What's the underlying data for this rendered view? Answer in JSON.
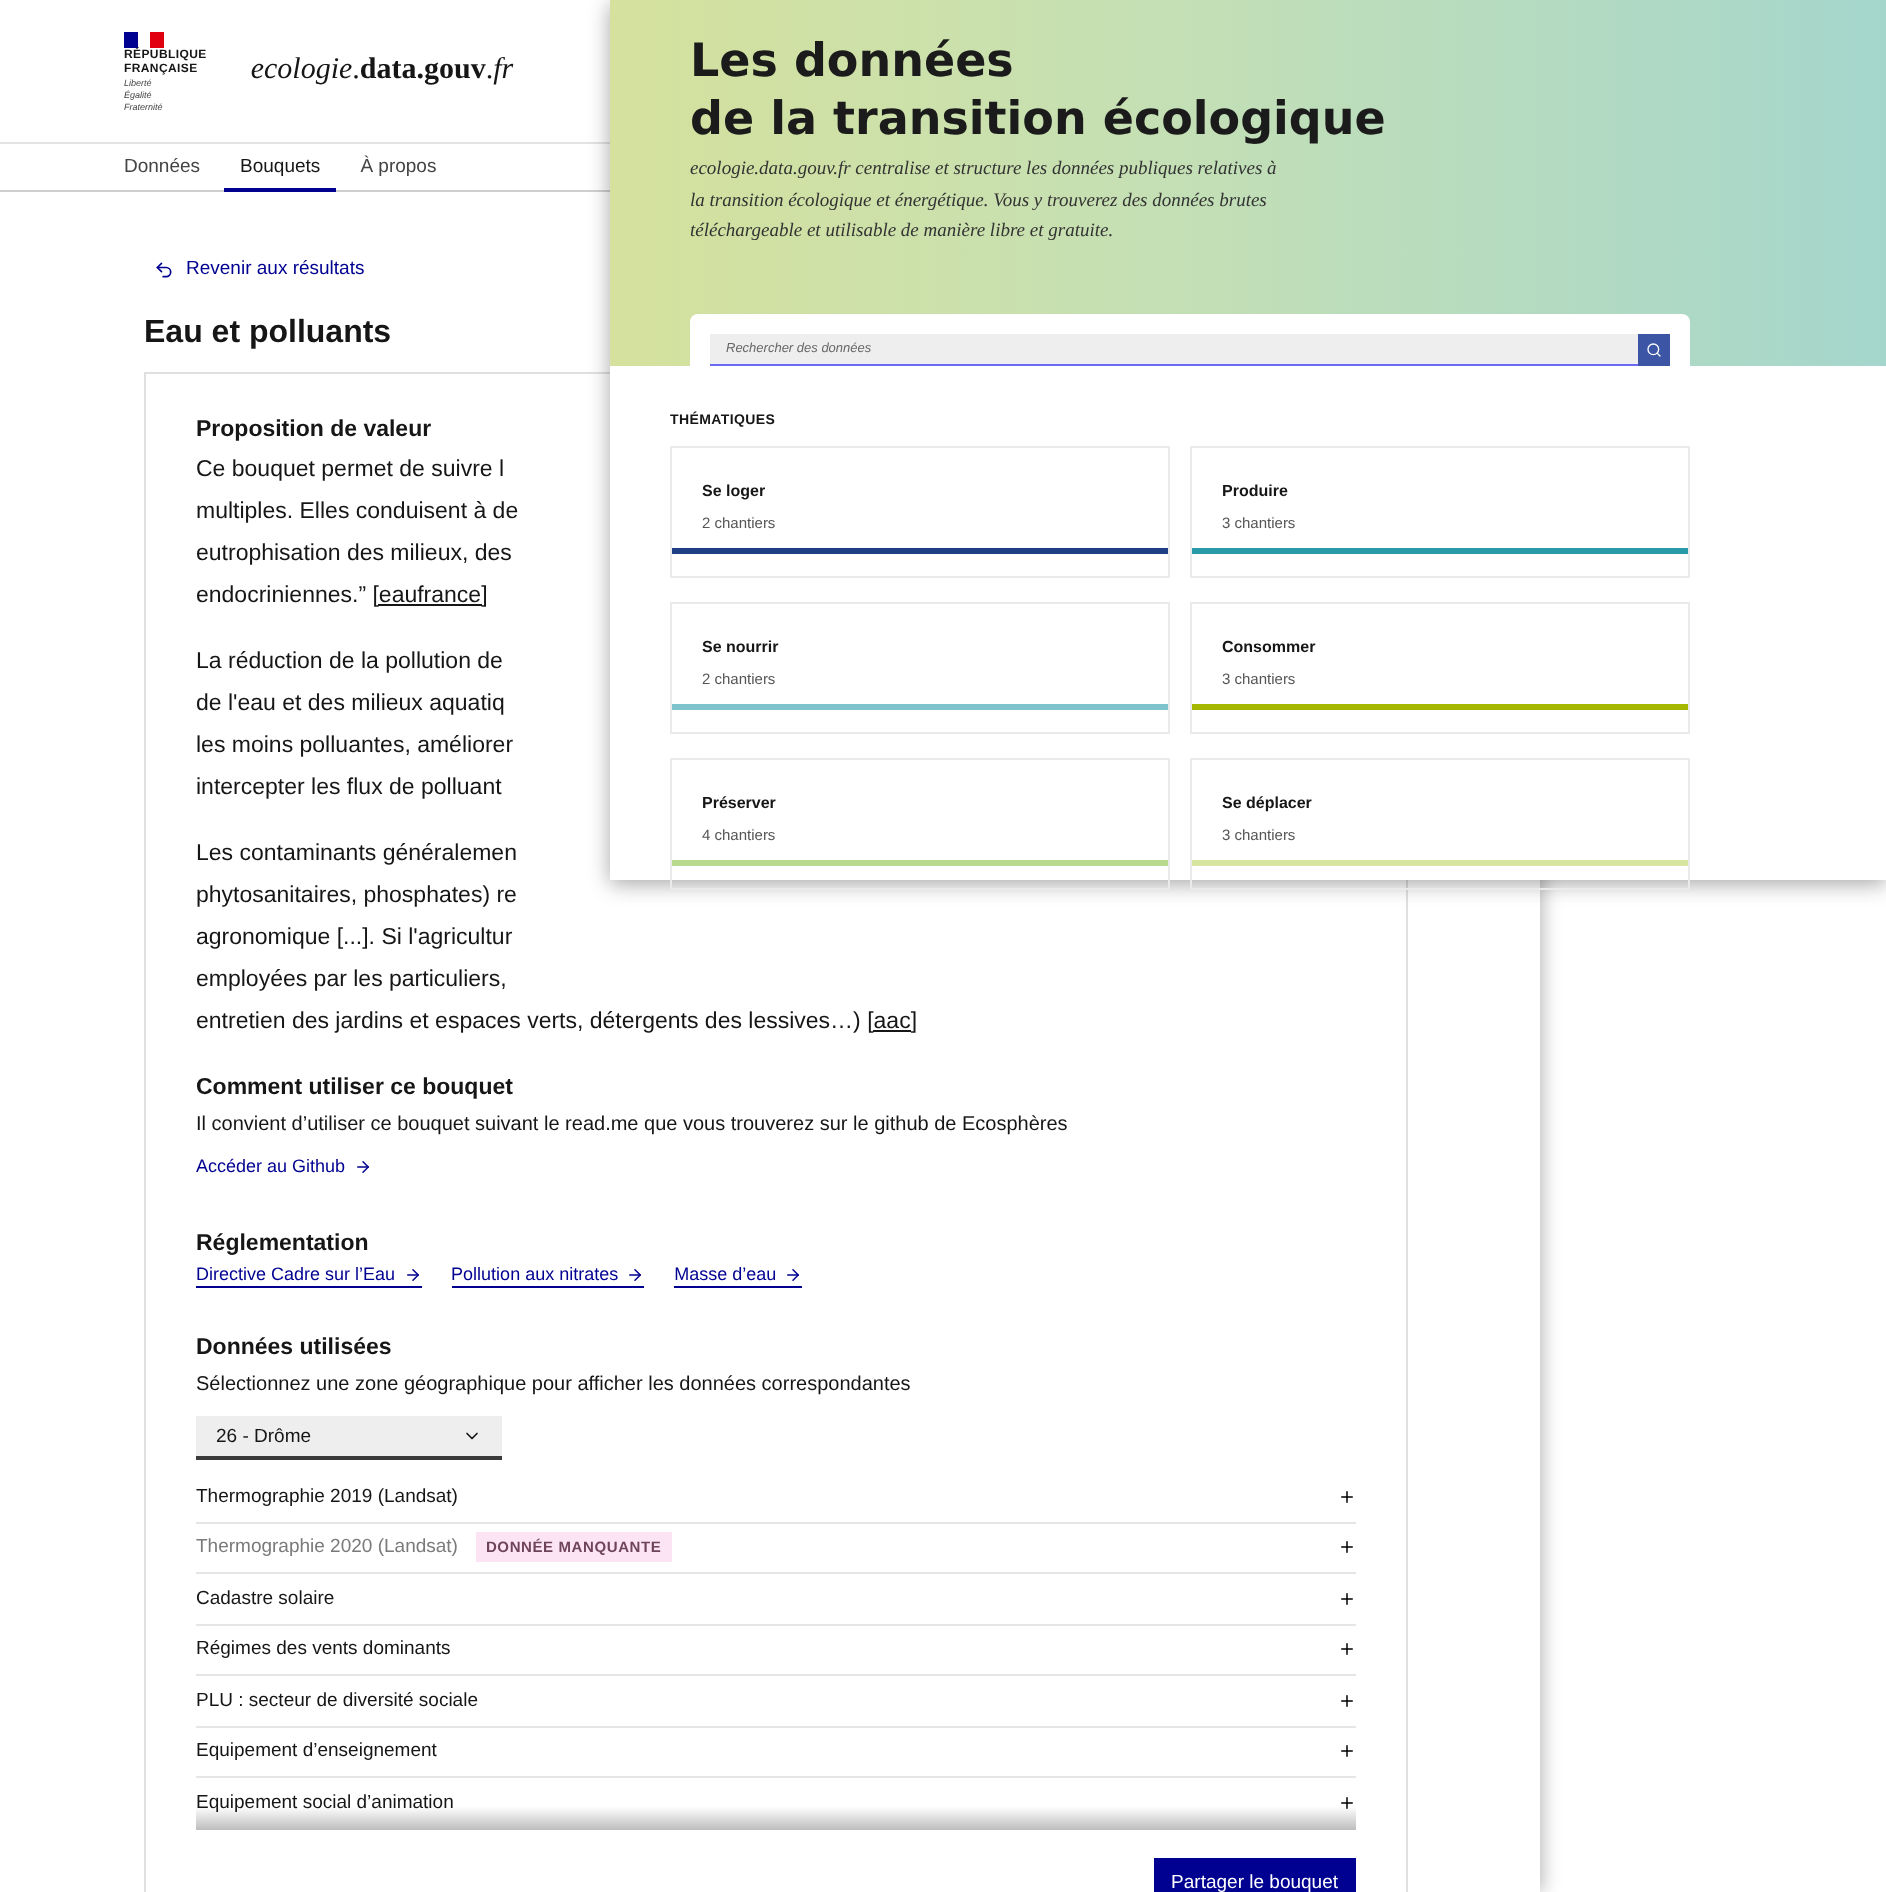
{
  "back_window": {
    "header": {
      "logo_lines": [
        "RÉPUBLIQUE",
        "FRANÇAISE"
      ],
      "motto_lines": [
        "Liberté",
        "Égalité",
        "Fraternité"
      ],
      "site_name": "*ecologie*.**data.gouv**.*fr*"
    },
    "nav": [
      {
        "label": "Données",
        "selected": false
      },
      {
        "label": "Bouquets",
        "selected": true
      },
      {
        "label": "À propos",
        "selected": false
      }
    ],
    "back_link": "Revenir aux résultats",
    "title": "Eau et polluants",
    "value_proposition": {
      "heading": "Proposition de valeur",
      "paragraphs": [
        {
          "lines": [
            {
              "text": "Ce bouquet permet de suivre l"
            },
            {
              "text": "multiples. Elles conduisent à de"
            },
            {
              "text": "eutrophisation des milieux, des"
            },
            {
              "text": "endocriniennes.”",
              "link": "[eaufrance]"
            }
          ]
        },
        {
          "lines": [
            {
              "text": "La réduction de la pollution de"
            },
            {
              "text": "de l'eau et des milieux aquatiq"
            },
            {
              "text": "les moins polluantes, améliorer"
            },
            {
              "text": "intercepter les flux de polluant"
            }
          ]
        },
        {
          "lines": [
            {
              "text": "Les contaminants généralemen"
            },
            {
              "text": "phytosanitaires, phosphates) re"
            },
            {
              "text": "agronomique [...]. Si l'agricultur"
            },
            {
              "text": "employées par les particuliers,"
            },
            {
              "text": "entretien des jardins et espaces verts, détergents des lessives…)",
              "link": "[aac]"
            }
          ]
        }
      ]
    },
    "usage": {
      "heading": "Comment utiliser ce bouquet",
      "text": "Il convient d’utiliser ce bouquet suivant le read.me que vous trouverez sur le github de Ecosphères",
      "link": "Accéder au Github"
    },
    "regulation": {
      "heading": "Réglementation",
      "links": [
        "Directive Cadre sur l’Eau",
        "Pollution aux nitrates",
        "Masse d’eau"
      ]
    },
    "data_used": {
      "heading": "Données utilisées",
      "instruction": "Sélectionnez une zone géographique pour afficher les données correspondantes",
      "zone_select": {
        "value": "26 - Drôme"
      },
      "datasets": [
        {
          "label": "Thermographie 2019 (Landsat)",
          "missing": false
        },
        {
          "label": "Thermographie 2020 (Landsat)",
          "missing": true,
          "badge": "DONNÉE MANQUANTE"
        },
        {
          "label": "Cadastre solaire",
          "missing": false
        },
        {
          "label": "Régimes des vents dominants",
          "missing": false
        },
        {
          "label": "PLU : secteur de diversité sociale",
          "missing": false
        },
        {
          "label": "Equipement d’enseignement",
          "missing": false
        },
        {
          "label": "Equipement social d’animation",
          "missing": false
        }
      ],
      "share_button": "Partager le bouquet"
    }
  },
  "front_window": {
    "title_lines": [
      "Les données",
      "de la transition écologique"
    ],
    "intro": "ecologie.data.gouv.fr centralise et structure les données publiques relatives à la transition écologique et énergétique. Vous y trouverez des données brutes téléchargeable et utilisable de manière libre et gratuite.",
    "search": {
      "placeholder": "Rechercher des données"
    },
    "section_label": "THÉMATIQUES",
    "themes": [
      {
        "name": "Se loger",
        "count": "2 chantiers",
        "color": "#1f3f84"
      },
      {
        "name": "Produire",
        "count": "3 chantiers",
        "color": "#2a9aa8"
      },
      {
        "name": "Se nourrir",
        "count": "2 chantiers",
        "color": "#7fc4cc"
      },
      {
        "name": "Consommer",
        "count": "3 chantiers",
        "color": "#a6b700"
      },
      {
        "name": "Préserver",
        "count": "4 chantiers",
        "color": "#b9d98f"
      },
      {
        "name": "Se déplacer",
        "count": "3 chantiers",
        "color": "#d8e5a0"
      }
    ]
  }
}
